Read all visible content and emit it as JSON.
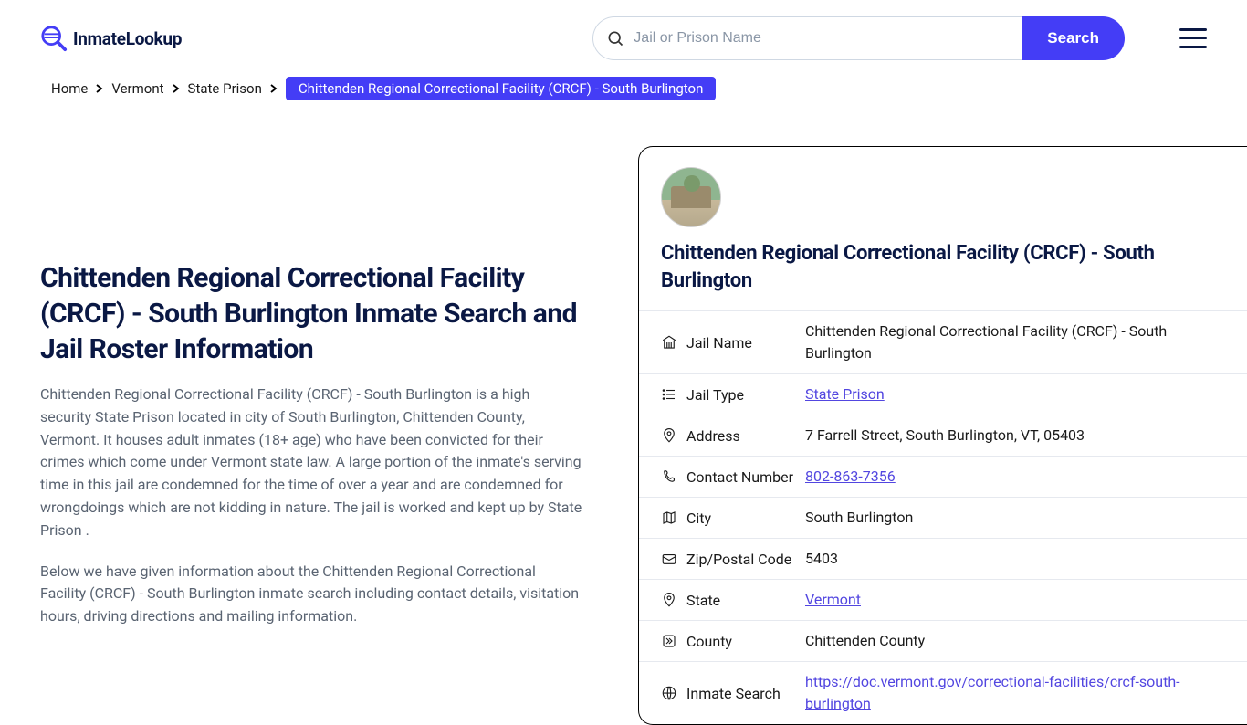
{
  "header": {
    "logo_text": "InmateLookup",
    "search_placeholder": "Jail or Prison Name",
    "search_button": "Search"
  },
  "breadcrumb": {
    "items": [
      "Home",
      "Vermont",
      "State Prison"
    ],
    "current": "Chittenden Regional Correctional Facility (CRCF) - South Burlington"
  },
  "main": {
    "title": "Chittenden Regional Correctional Facility (CRCF) - South Burlington Inmate Search and Jail Roster Information",
    "para1": "Chittenden Regional Correctional Facility (CRCF) - South Burlington is a high security State Prison located in city of South Burlington, Chittenden County, Vermont. It houses adult inmates (18+ age) who have been convicted for their crimes which come under Vermont state law. A large portion of the inmate's serving time in this jail are condemned for the time of over a year and are condemned for wrongdoings which are not kidding in nature. The jail is worked and kept up by State Prison .",
    "para2": "Below we have given information about the Chittenden Regional Correctional Facility (CRCF) - South Burlington inmate search including contact details, visitation hours, driving directions and mailing information."
  },
  "card": {
    "title": "Chittenden Regional Correctional Facility (CRCF) - South Burlington",
    "rows": [
      {
        "label": "Jail Name",
        "value": "Chittenden Regional Correctional Facility (CRCF) - South Burlington",
        "link": false
      },
      {
        "label": "Jail Type",
        "value": "State Prison",
        "link": true
      },
      {
        "label": "Address",
        "value": "7 Farrell Street, South Burlington, VT, 05403",
        "link": false
      },
      {
        "label": "Contact Number",
        "value": "802-863-7356",
        "link": true
      },
      {
        "label": "City",
        "value": "South Burlington",
        "link": false
      },
      {
        "label": "Zip/Postal Code",
        "value": "5403",
        "link": false
      },
      {
        "label": "State",
        "value": "Vermont",
        "link": true
      },
      {
        "label": "County",
        "value": "Chittenden County",
        "link": false
      },
      {
        "label": "Inmate Search",
        "value": "https://doc.vermont.gov/correctional-facilities/crcf-south-burlington",
        "link": true
      }
    ]
  }
}
